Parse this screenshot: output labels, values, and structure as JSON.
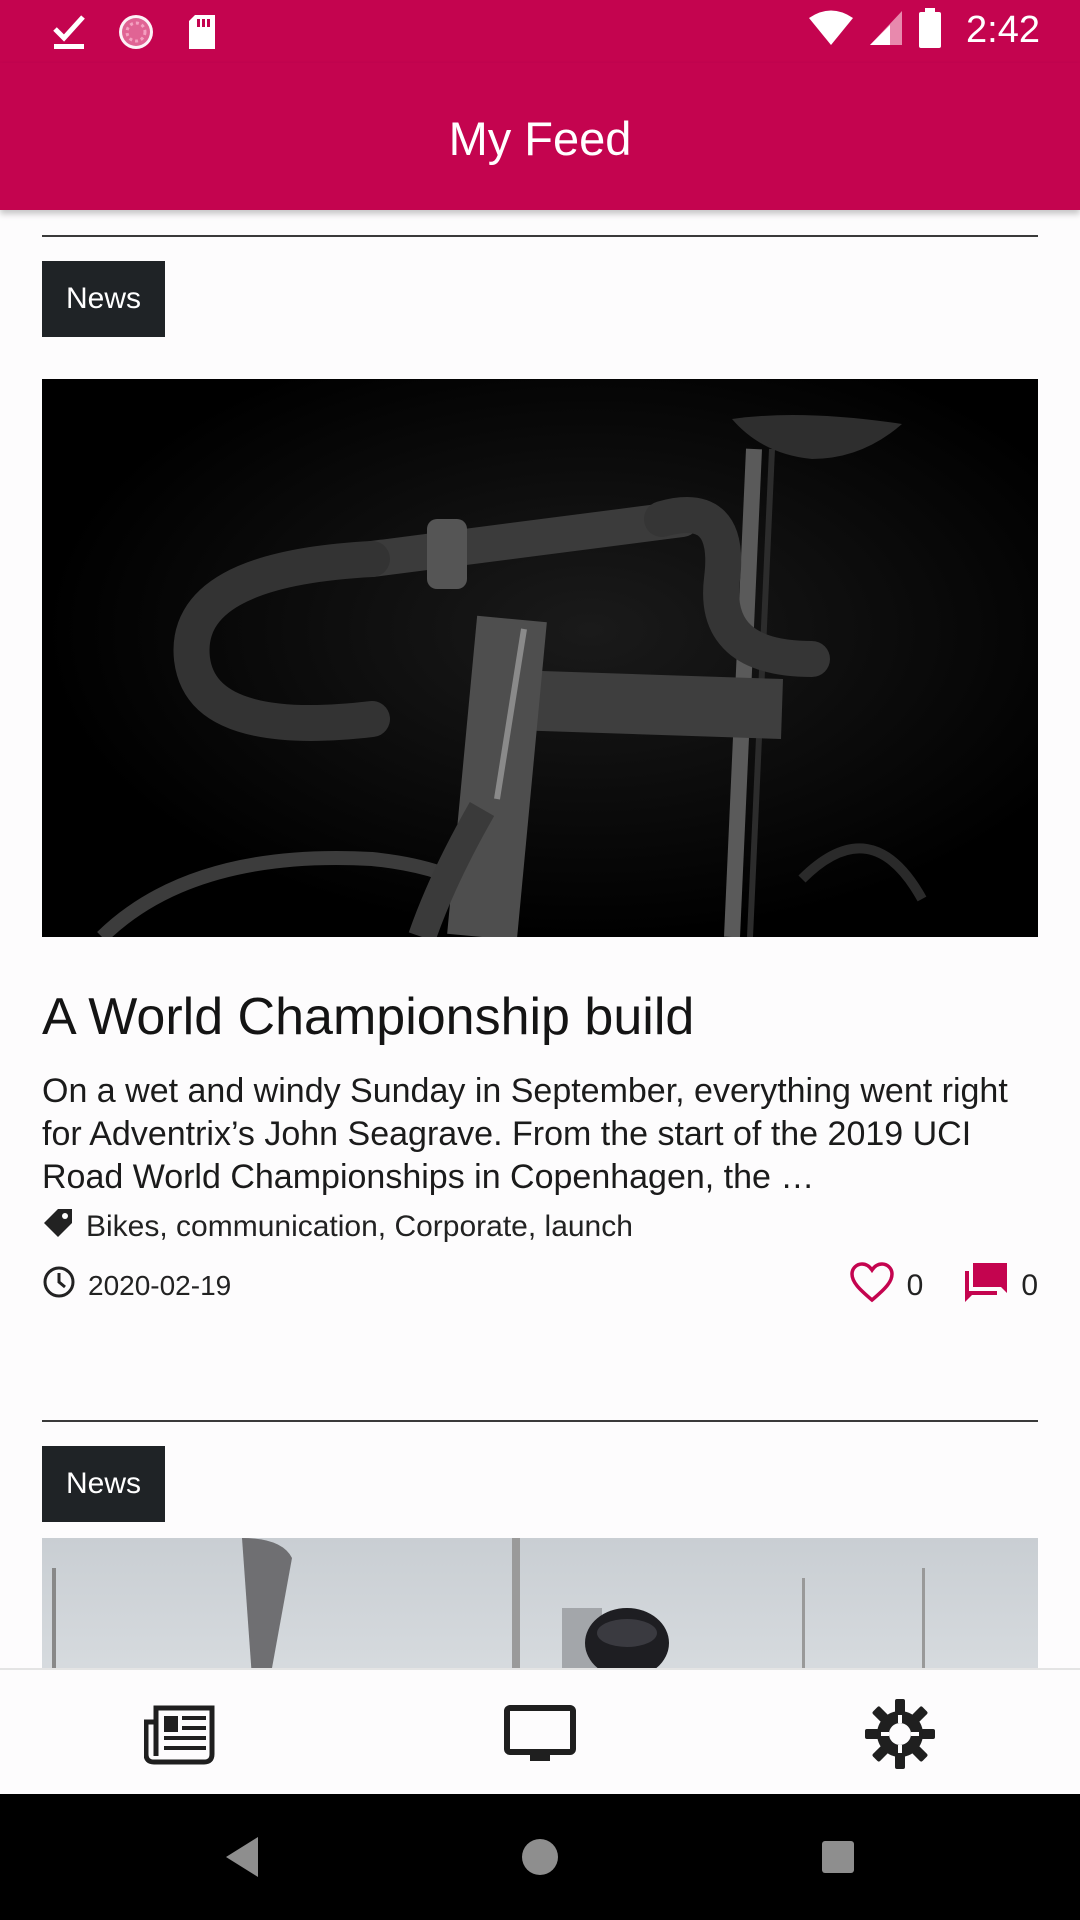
{
  "status_bar": {
    "time": "2:42",
    "left_icons": [
      "checkmark-download-icon",
      "sync-circle-icon",
      "sd-card-icon"
    ],
    "right_icons": [
      "wifi-icon",
      "cell-signal-icon",
      "battery-icon"
    ]
  },
  "app_bar": {
    "title": "My Feed"
  },
  "colors": {
    "primary": "#c4044f",
    "badge_bg": "#1f2326",
    "text": "#1b1b1b"
  },
  "feed": {
    "cards": [
      {
        "category": "News",
        "title": "A World Championship build",
        "excerpt": "On a wet and windy Sunday in September, everything went right for Adventrix’s John Seagrave. From the start of the 2019 UCI Road World Championships in Copenhagen, the …",
        "tags": "Bikes, communication, Corporate, launch",
        "date": "2020-02-19",
        "likes": "0",
        "comments": "0",
        "image": "bicycle-photo"
      },
      {
        "category": "News",
        "image": "cyclist-photo"
      }
    ]
  },
  "bottom_nav": {
    "items": [
      {
        "icon": "news-icon"
      },
      {
        "icon": "tv-icon"
      },
      {
        "icon": "settings-gear-icon"
      }
    ]
  },
  "system_nav": {
    "items": [
      "back-icon",
      "home-icon",
      "recents-icon"
    ]
  }
}
